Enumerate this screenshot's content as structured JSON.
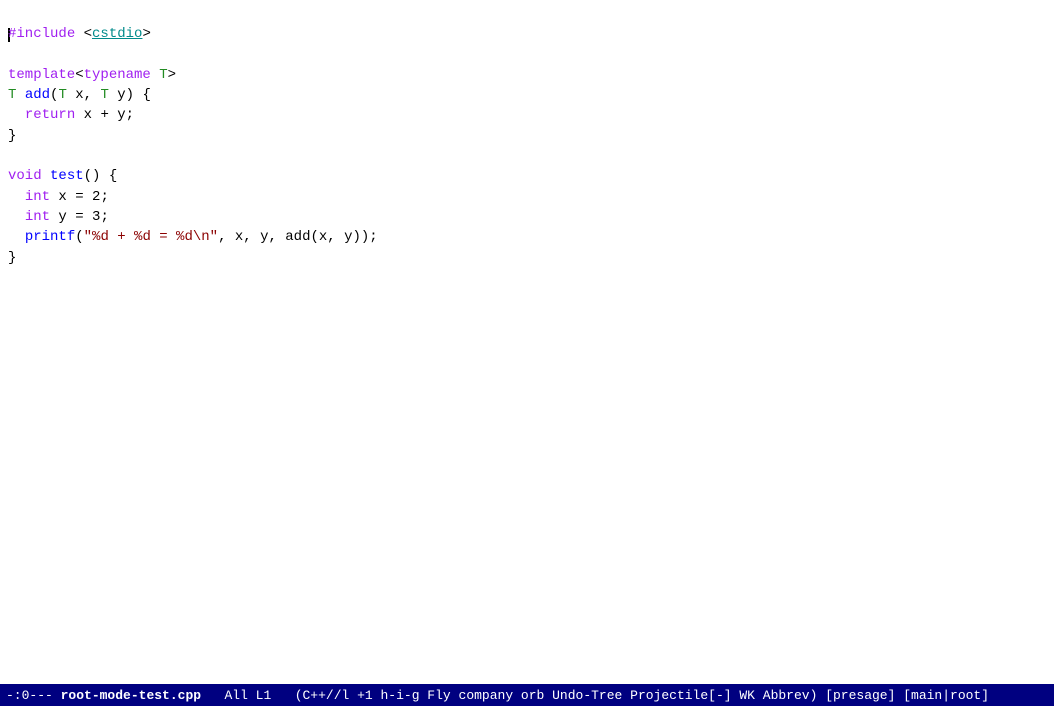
{
  "editor": {
    "lines": [
      {
        "id": "line1",
        "tokens": [
          {
            "text": "#",
            "class": "kw-include"
          },
          {
            "text": "include",
            "class": "kw-include"
          },
          {
            "text": " <",
            "class": "normal"
          },
          {
            "text": "cstdio",
            "class": "kw-header"
          },
          {
            "text": ">",
            "class": "normal"
          }
        ],
        "has_cursor": true,
        "cursor_before": "#"
      },
      {
        "id": "line2",
        "tokens": [],
        "text": ""
      },
      {
        "id": "line3",
        "tokens": [
          {
            "text": "template",
            "class": "kw-template"
          },
          {
            "text": "<",
            "class": "normal"
          },
          {
            "text": "typename",
            "class": "kw-typename"
          },
          {
            "text": " ",
            "class": "normal"
          },
          {
            "text": "T",
            "class": "kw-type-T"
          },
          {
            "text": ">",
            "class": "normal"
          }
        ]
      },
      {
        "id": "line4",
        "tokens": [
          {
            "text": "T",
            "class": "kw-type-T"
          },
          {
            "text": " ",
            "class": "normal"
          },
          {
            "text": "add",
            "class": "fn-name"
          },
          {
            "text": "(",
            "class": "normal"
          },
          {
            "text": "T",
            "class": "kw-type-T"
          },
          {
            "text": " x, ",
            "class": "normal"
          },
          {
            "text": "T",
            "class": "kw-type-T"
          },
          {
            "text": " y) {",
            "class": "normal"
          }
        ]
      },
      {
        "id": "line5",
        "tokens": [
          {
            "text": "  ",
            "class": "normal"
          },
          {
            "text": "return",
            "class": "kw-return"
          },
          {
            "text": " x + y;",
            "class": "normal"
          }
        ]
      },
      {
        "id": "line6",
        "tokens": [
          {
            "text": "}",
            "class": "normal"
          }
        ]
      },
      {
        "id": "line7",
        "tokens": []
      },
      {
        "id": "line8",
        "tokens": [
          {
            "text": "void",
            "class": "kw-void"
          },
          {
            "text": " ",
            "class": "normal"
          },
          {
            "text": "test",
            "class": "fn-name"
          },
          {
            "text": "() {",
            "class": "normal"
          }
        ]
      },
      {
        "id": "line9",
        "tokens": [
          {
            "text": "  ",
            "class": "normal"
          },
          {
            "text": "int",
            "class": "kw-int"
          },
          {
            "text": " x = 2;",
            "class": "normal"
          }
        ]
      },
      {
        "id": "line10",
        "tokens": [
          {
            "text": "  ",
            "class": "normal"
          },
          {
            "text": "int",
            "class": "kw-int"
          },
          {
            "text": " y = 3;",
            "class": "normal"
          }
        ]
      },
      {
        "id": "line11",
        "tokens": [
          {
            "text": "  ",
            "class": "normal"
          },
          {
            "text": "printf",
            "class": "fn-name"
          },
          {
            "text": "(",
            "class": "normal"
          },
          {
            "text": "\"%d + %d = %d\\n\"",
            "class": "str-literal"
          },
          {
            "text": ", x, y, add(x, y));",
            "class": "normal"
          }
        ]
      },
      {
        "id": "line12",
        "tokens": [
          {
            "text": "}",
            "class": "normal"
          }
        ]
      }
    ]
  },
  "status_bar": {
    "mode_indicators": "-:0---",
    "filename": "root-mode-test.cpp",
    "position": "All L1",
    "modes": "(C++//l +1 h-i-g Fly company orb Undo-Tree Projectile[-] WK Abbrev)",
    "extra": "[presage]",
    "main_mode": "[main|root]"
  },
  "minibuffer": {
    "text": ""
  }
}
